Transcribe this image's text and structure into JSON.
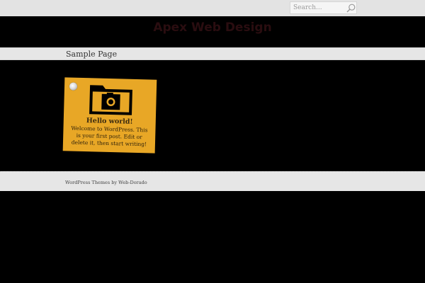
{
  "search": {
    "placeholder": "Search..."
  },
  "header": {
    "site_title": "Apex Web Design"
  },
  "nav": {
    "items": [
      {
        "label": "Sample Page"
      }
    ]
  },
  "posts": [
    {
      "title": "Hello world!",
      "excerpt": "Welcome to WordPress. This is your first post. Edit or delete it, then start writing!",
      "thumbnail_icon": "camera-folder-icon"
    }
  ],
  "footer": {
    "prefix": "WordPress Themes by ",
    "link_text": "Web-Dorado"
  },
  "colors": {
    "background": "#000000",
    "bar": "#e6e6e6",
    "note": "#e8a726",
    "title": "#2a0d10"
  }
}
